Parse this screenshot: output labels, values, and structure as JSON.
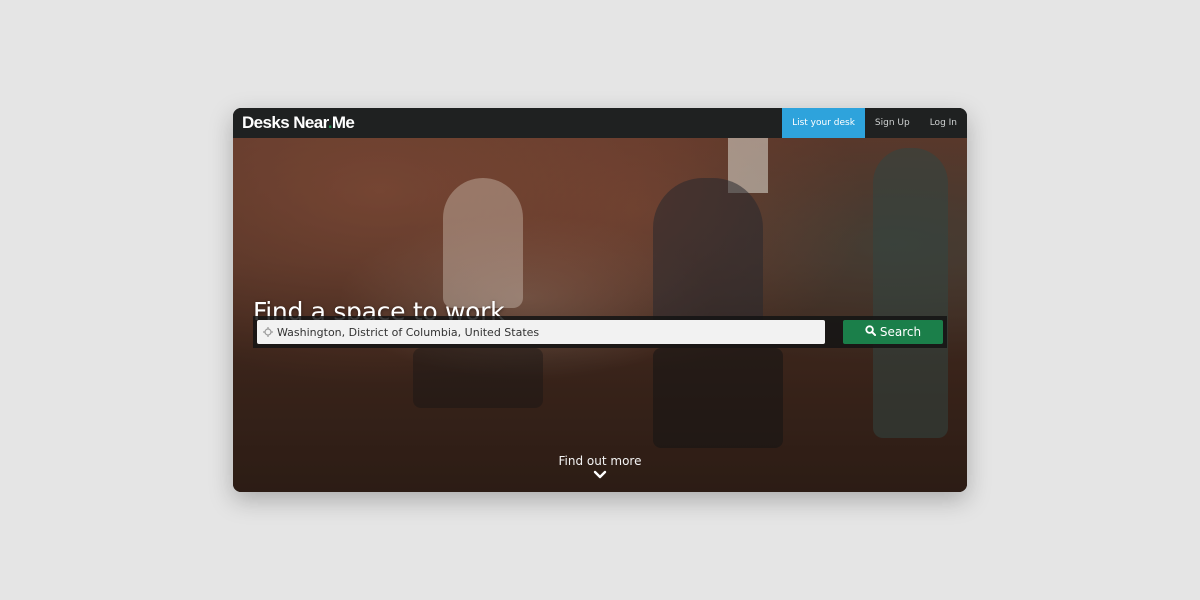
{
  "navbar": {
    "logo_part1": "Desks Near",
    "logo_dot": ".",
    "logo_part2": "Me",
    "items": [
      {
        "label": "List your desk",
        "primary": true
      },
      {
        "label": "Sign Up",
        "primary": false
      },
      {
        "label": "Log In",
        "primary": false
      }
    ]
  },
  "hero": {
    "title": "Find a space to work",
    "search": {
      "value": "Washington, District of Columbia, United States",
      "icon": "location-crosshair-icon",
      "button_label": "Search",
      "button_icon": "search-icon"
    },
    "find_out_more": "Find out more",
    "find_out_more_icon": "chevron-down-icon"
  },
  "colors": {
    "primary_nav": "#2ea3dc",
    "search_button": "#1b7f4a",
    "logo_dot": "#1d8a4f",
    "navbar_bg": "#1f2121",
    "page_bg": "#e5e5e5"
  }
}
